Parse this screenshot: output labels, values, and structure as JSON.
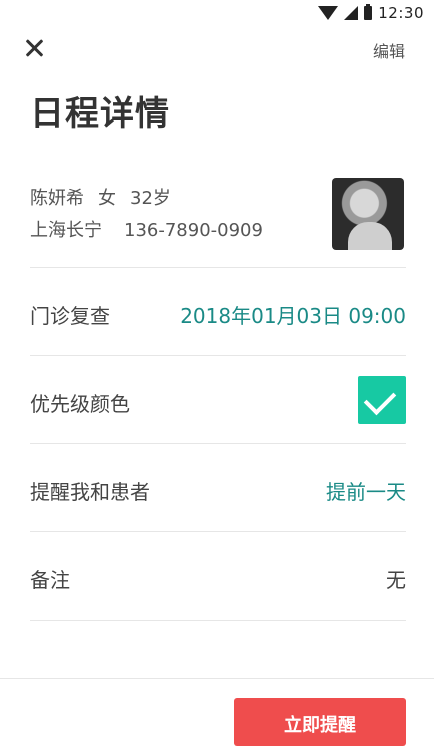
{
  "status_bar": {
    "time": "12:30",
    "icons": [
      "wifi-icon",
      "cellular-icon",
      "battery-icon"
    ]
  },
  "header": {
    "close_icon": "close-icon",
    "edit_label": "编辑"
  },
  "page_title": "日程详情",
  "patient": {
    "name": "陈妍希",
    "gender": "女",
    "age": "32岁",
    "district": "上海长宁",
    "phone": "136-7890-0909"
  },
  "rows": {
    "visit_type": {
      "label": "门诊复查",
      "value": "2018年01月03日 09:00"
    },
    "priority": {
      "label": "优先级颜色",
      "checked": true,
      "color": "#17c9a3"
    },
    "reminder": {
      "label": "提醒我和患者",
      "value": "提前一天"
    },
    "note": {
      "label": "备注",
      "value": "无"
    }
  },
  "footer": {
    "remind_button_label": "立即提醒",
    "button_color": "#ef4d4d"
  },
  "colors": {
    "accent_teal": "#1a8a86",
    "check_green": "#17c9a3"
  }
}
